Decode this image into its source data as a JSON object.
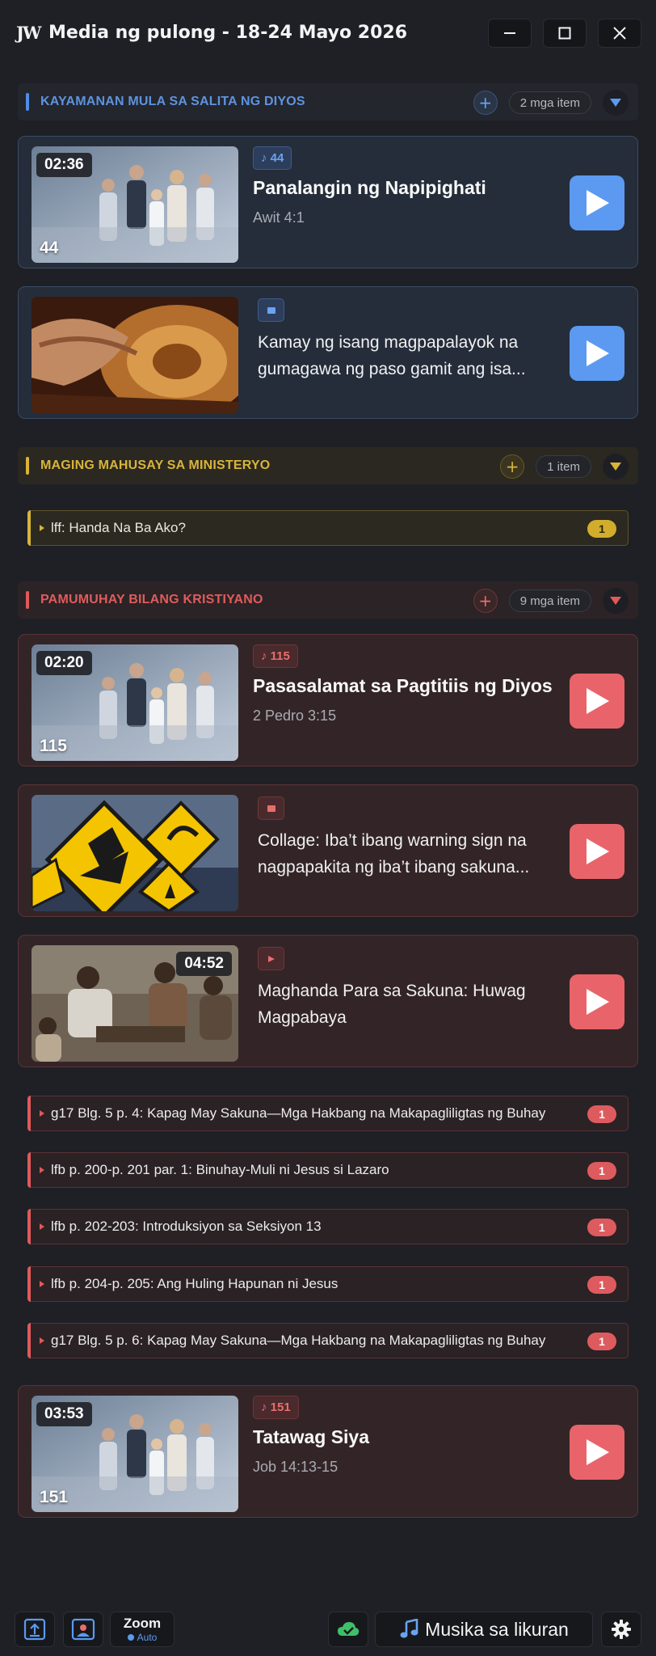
{
  "app": {
    "logo": "JW",
    "title": "Media ng pulong - 18-24 Mayo 2026",
    "minimize_icon": "minimize-icon",
    "maximize_icon": "maximize-icon",
    "close_icon": "close-icon"
  },
  "colors": {
    "bg": "#1e2026",
    "blue": "#5b9af0",
    "gold": "#d8b43a",
    "red": "#e9646a"
  },
  "sections": [
    {
      "title": "KAYAMANAN MULA SA SALITA NG DIYOS",
      "count": "2 mga item",
      "color": "#5e93df",
      "cards": [
        {
          "duration": "02:36",
          "song_number": "44",
          "tag": "♪ 44",
          "title": "Panalangin ng Napipighati",
          "subtitle": "Awit 4:1",
          "icon": "play-icon"
        },
        {
          "tag_icon": "image-icon",
          "description": "Kamay ng isang magpapalayok na gumagawa ng paso gamit ang isa...",
          "icon": "play-icon"
        }
      ]
    },
    {
      "title": "MAGING MAHUSAY SA MINISTERYO",
      "count": "1 item",
      "color": "#d8b43a",
      "rows": [
        {
          "label": "lff: Handa Na Ba Ako?",
          "badge": "1"
        }
      ]
    },
    {
      "title": "PAMUMUHAY BILANG KRISTIYANO",
      "count": "9 mga item",
      "color": "#df5c5c",
      "cards": [
        {
          "duration": "02:20",
          "song_number": "115",
          "tag": "♪ 115",
          "title": "Pasasalamat sa Pagtitiis ng Diyos",
          "subtitle": "2 Pedro 3:15"
        },
        {
          "tag_icon": "image-icon",
          "description": "Collage: Iba’t ibang warning sign na nagpapakita ng iba’t ibang sakuna..."
        },
        {
          "duration": "04:52",
          "tag_icon": "video-icon",
          "description": "Maghanda Para sa Sakuna: Huwag Magpabaya"
        }
      ],
      "rows": [
        {
          "label": "g17 Blg. 5 p. 4: Kapag May Sakuna—Mga Hakbang na Makapagliligtas ng Buhay",
          "badge": "1"
        },
        {
          "label": "lfb p. 200-p. 201 par. 1: Binuhay-Muli ni Jesus si Lazaro",
          "badge": "1"
        },
        {
          "label": "lfb p. 202-203: Introduksiyon sa Seksiyon 13",
          "badge": "1"
        },
        {
          "label": "lfb p. 204-p. 205: Ang Huling Hapunan ni Jesus",
          "badge": "1"
        },
        {
          "label": "g17 Blg. 5 p. 6: Kapag May Sakuna—Mga Hakbang na Makapagliligtas ng Buhay",
          "badge": "1"
        }
      ],
      "closing_card": {
        "duration": "03:53",
        "song_number": "151",
        "tag": "♪ 151",
        "title": "Tatawag Siya",
        "subtitle": "Job 14:13-15"
      }
    }
  ],
  "bottom": {
    "zoom_label": "Zoom",
    "zoom_mode": "Auto",
    "music_label": "Musika sa likuran",
    "upload_icon": "upload-icon",
    "presenter_icon": "presenter-icon",
    "sync_icon": "cloud-check-icon",
    "music_icon": "music-note-icon",
    "settings_icon": "gear-icon"
  }
}
